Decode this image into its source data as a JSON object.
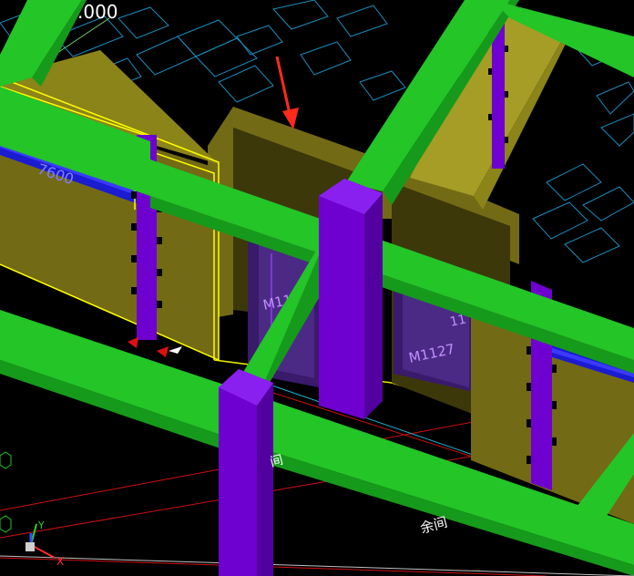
{
  "viewport": {
    "labels": {
      "elevation": ".000",
      "dimension": "7600",
      "door_a": "M1127",
      "door_b": "M1127",
      "dim_b": "11",
      "room_left": "间",
      "room_name": "余间"
    },
    "axes": {
      "x": "X",
      "y": "Y"
    },
    "colors": {
      "background": "#000000",
      "beam": "#23c527",
      "beam_dark": "#169a1b",
      "column": "#6e00d0",
      "column_dark": "#5200a0",
      "wall": "#736a15",
      "wall_dark": "#5a520e",
      "selection": "#ffff00",
      "grid": "#1b8bbb",
      "arrow": "#ff2a1a"
    }
  }
}
